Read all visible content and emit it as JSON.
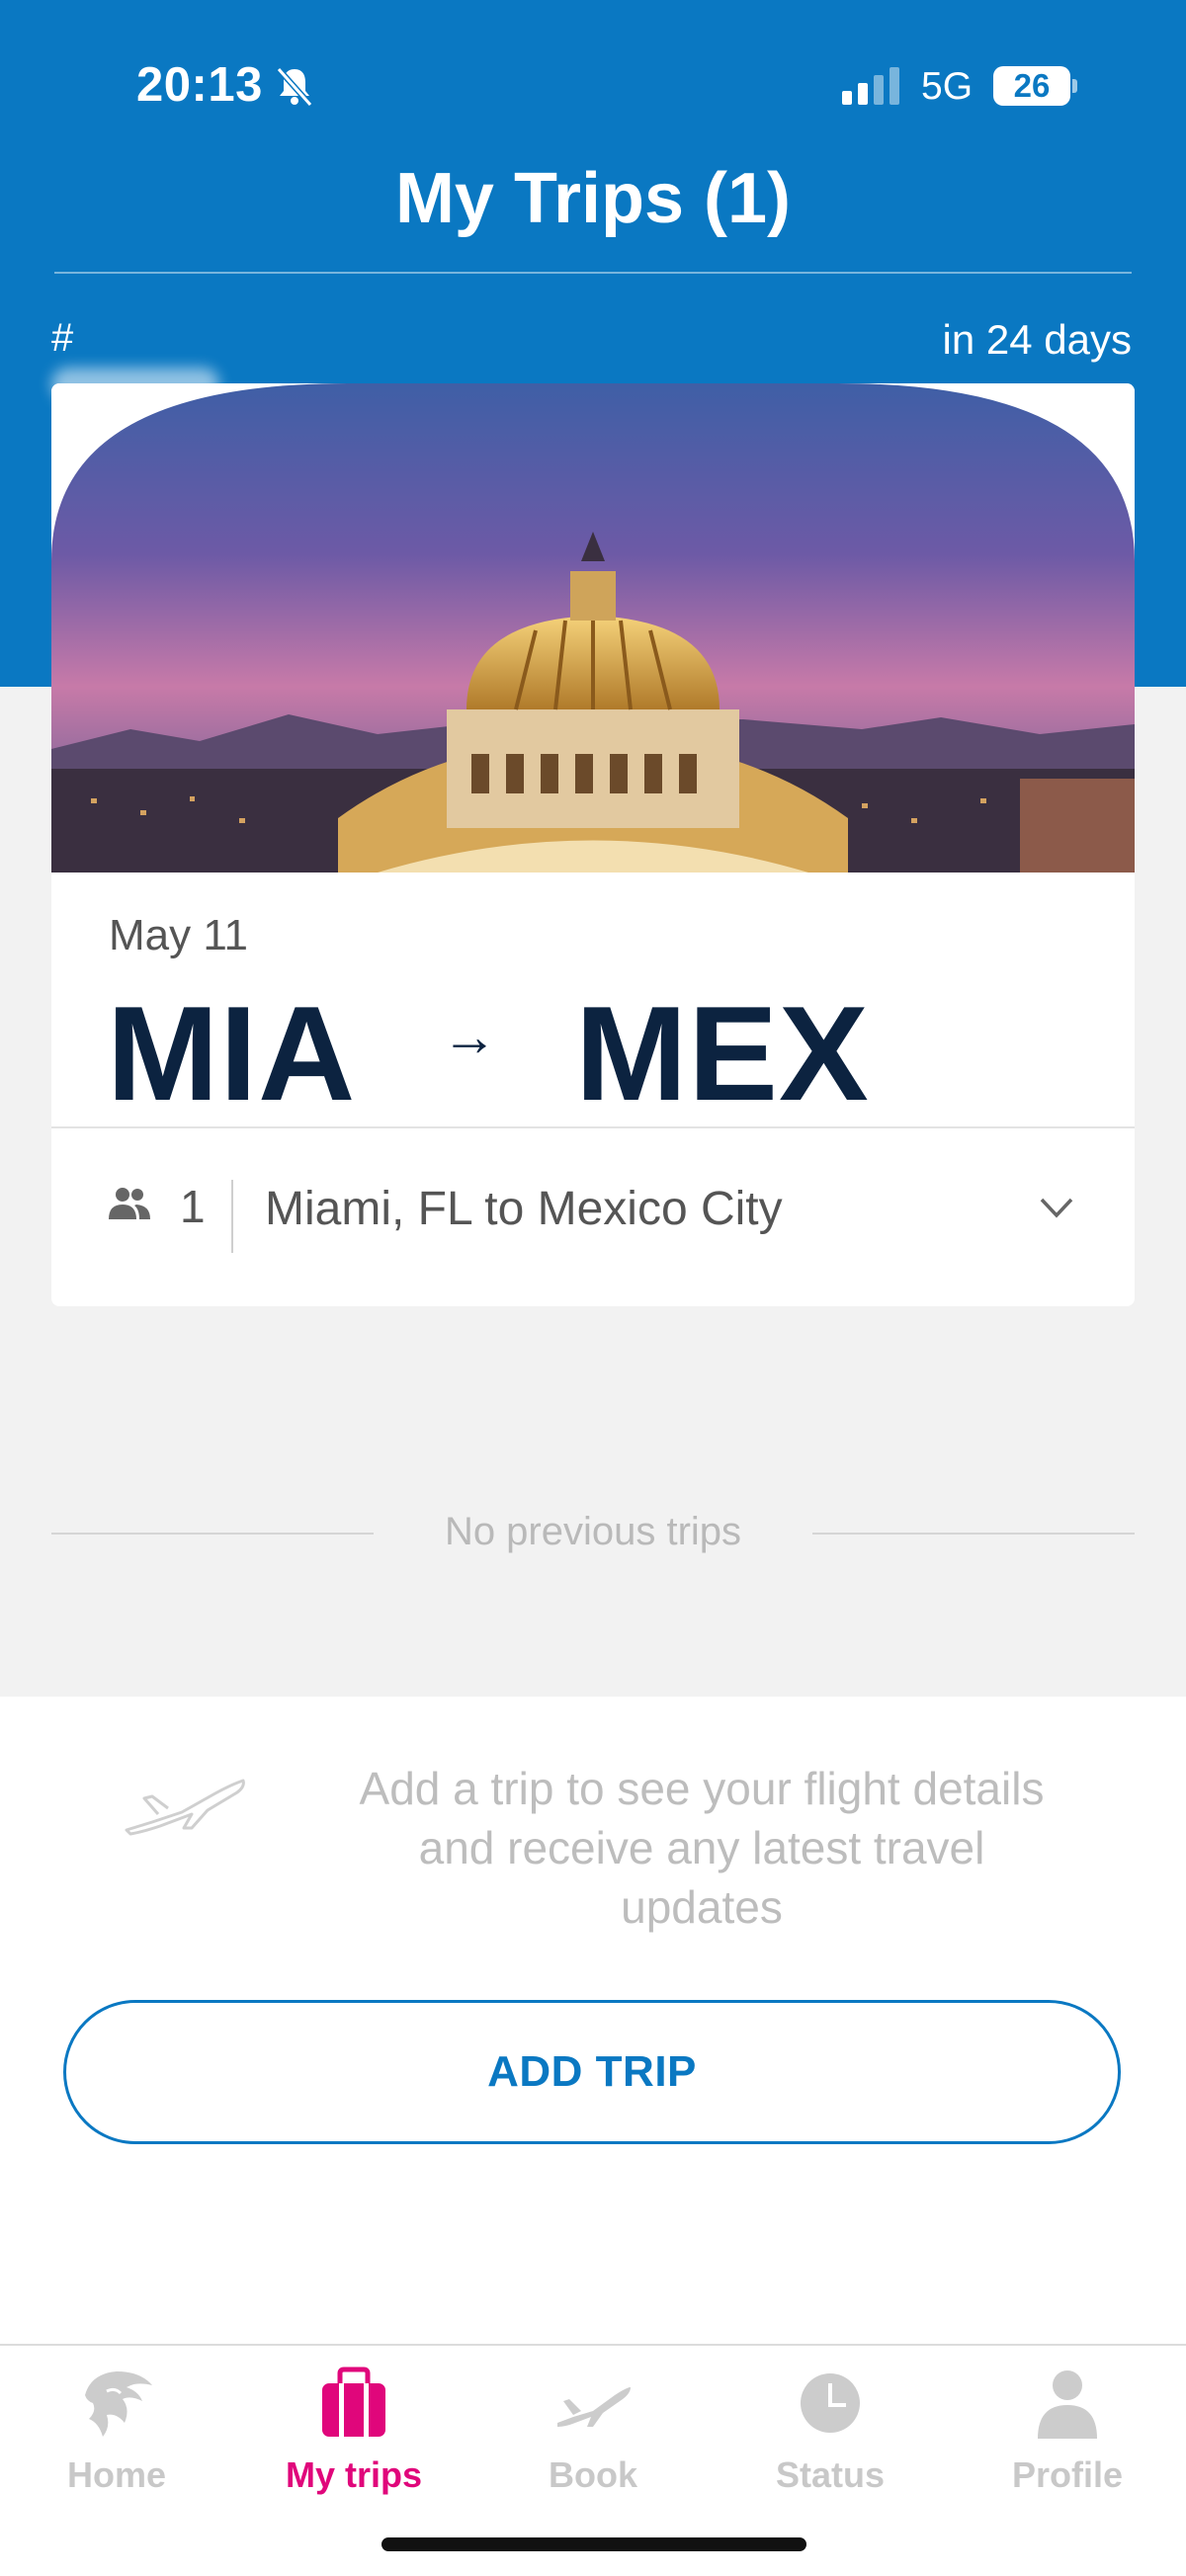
{
  "status_bar": {
    "time": "20:13",
    "network": "5G",
    "battery": "26",
    "icons": [
      "bell-slash-icon",
      "signal-icon",
      "battery-icon"
    ]
  },
  "header": {
    "title": "My Trips (1)",
    "booking_ref_prefix": "#",
    "countdown": "in 24 days"
  },
  "trip": {
    "date": "May 11",
    "origin": "MIA",
    "arrow": "→",
    "destination": "MEX",
    "passengers": "1",
    "route_description": "Miami, FL to Mexico City"
  },
  "previous_trips": {
    "label": "No previous trips"
  },
  "add_trip": {
    "message": "Add a trip to see your flight details and receive any latest travel updates",
    "button_label": "ADD TRIP"
  },
  "tabs": [
    {
      "label": "Home",
      "icon": "eagle-icon",
      "active": false
    },
    {
      "label": "My trips",
      "icon": "suitcase-icon",
      "active": true
    },
    {
      "label": "Book",
      "icon": "plane-icon",
      "active": false
    },
    {
      "label": "Status",
      "icon": "clock-icon",
      "active": false
    },
    {
      "label": "Profile",
      "icon": "person-icon",
      "active": false
    }
  ],
  "colors": {
    "header_blue": "#0a78c2",
    "navy": "#0c2340",
    "active_tab": "#e0067b"
  }
}
